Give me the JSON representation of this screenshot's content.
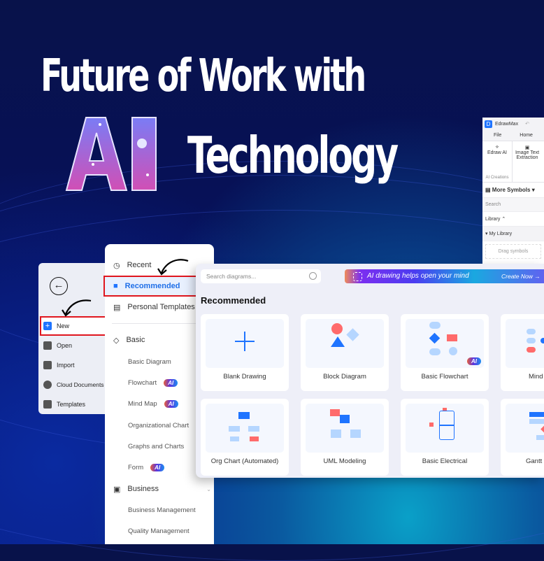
{
  "headline": {
    "line1": "Future of Work with",
    "ai_word": "AI",
    "line2": "Technology"
  },
  "colors": {
    "background": "#08124a",
    "accent_blue": "#1f74ff",
    "highlight_red": "#e0161e",
    "shape_red": "#ff6b6b",
    "shape_light_blue": "#b5d6ff"
  },
  "edraw_window": {
    "app_name": "EdrawMax",
    "menu": [
      "File",
      "Home"
    ],
    "ribbon": [
      {
        "label": "Edraw AI",
        "icon": "edraw-ai-icon"
      },
      {
        "label": "Image Text Extraction",
        "icon": "ocr-icon"
      }
    ],
    "ribbon_group": "AI Creations",
    "more_symbols": "More Symbols",
    "search_placeholder": "Search",
    "library_label": "Library",
    "my_library": "My Library",
    "drag_hint": "Drag symbols"
  },
  "file_menu": {
    "items": [
      {
        "label": "New",
        "icon": "plus-icon",
        "highlighted": true
      },
      {
        "label": "Open",
        "icon": "folder-icon"
      },
      {
        "label": "Import",
        "icon": "import-icon"
      },
      {
        "label": "Cloud Documents",
        "icon": "cloud-icon"
      },
      {
        "label": "Templates",
        "icon": "templates-icon"
      }
    ]
  },
  "categories": {
    "top": [
      {
        "label": "Recent",
        "icon": "clock-icon"
      },
      {
        "label": "Recommended",
        "icon": "bookmark-star-icon",
        "selected": true
      },
      {
        "label": "Personal Templates",
        "icon": "template-doc-icon"
      }
    ],
    "basic": {
      "label": "Basic",
      "icon": "tag-icon",
      "items": [
        {
          "label": "Basic Diagram",
          "ai": false
        },
        {
          "label": "Flowchart",
          "ai": true
        },
        {
          "label": "Mind Map",
          "ai": true
        },
        {
          "label": "Organizational Chart",
          "ai": false
        },
        {
          "label": "Graphs and Charts",
          "ai": false
        },
        {
          "label": "Form",
          "ai": true
        }
      ]
    },
    "business": {
      "label": "Business",
      "icon": "presentation-icon",
      "items": [
        {
          "label": "Business Management"
        },
        {
          "label": "Quality Management"
        }
      ]
    },
    "ai_badge": "AI"
  },
  "main": {
    "search_placeholder": "Search diagrams...",
    "banner_text": "AI drawing helps open your mind",
    "banner_cta": "Create Now →",
    "section_title": "Recommended",
    "cards": [
      {
        "label": "Blank Drawing"
      },
      {
        "label": "Block Diagram"
      },
      {
        "label": "Basic Flowchart",
        "ai": true
      },
      {
        "label": "Mind"
      },
      {
        "label": "Org Chart (Automated)"
      },
      {
        "label": "UML Modeling"
      },
      {
        "label": "Basic Electrical"
      },
      {
        "label": "Gantt C"
      }
    ]
  }
}
